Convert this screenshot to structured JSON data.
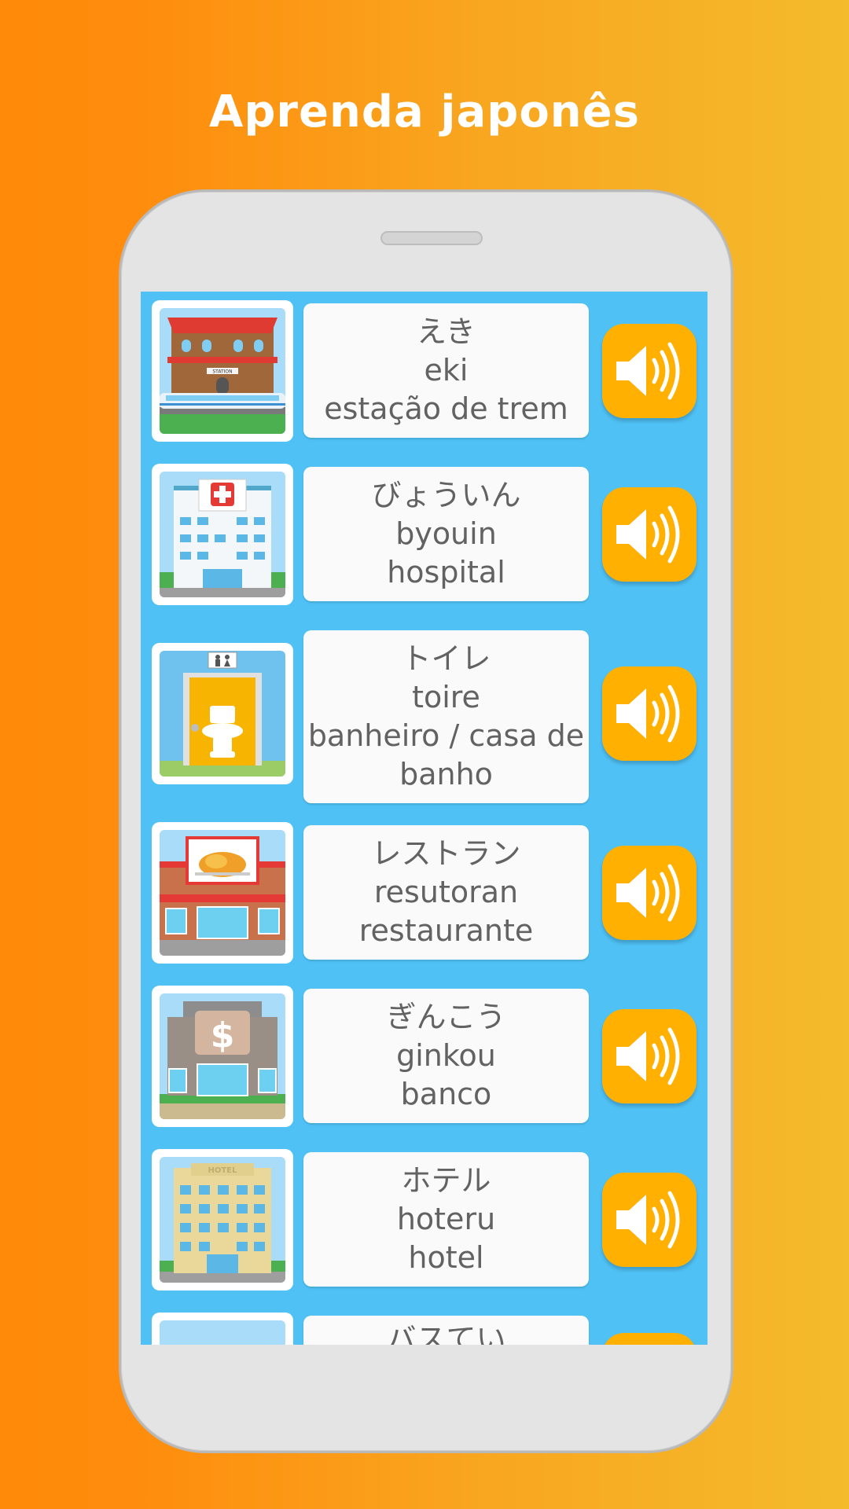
{
  "headline": "Aprenda japonês",
  "colors": {
    "accent": "#ffb000",
    "screen": "#4fc1f5",
    "card": "#fafafa",
    "text": "#626262"
  },
  "words": [
    {
      "kana": "えき",
      "romaji": "eki",
      "translation": "estação de trem",
      "image_icon": "train-station-icon"
    },
    {
      "kana": "びょういん",
      "romaji": "byouin",
      "translation": "hospital",
      "image_icon": "hospital-icon"
    },
    {
      "kana": "トイレ",
      "romaji": "toire",
      "translation": "banheiro / casa de banho",
      "image_icon": "toilet-icon"
    },
    {
      "kana": "レストラン",
      "romaji": "resutoran",
      "translation": "restaurante",
      "image_icon": "restaurant-icon"
    },
    {
      "kana": "ぎんこう",
      "romaji": "ginkou",
      "translation": "banco",
      "image_icon": "bank-icon"
    },
    {
      "kana": "ホテル",
      "romaji": "hoteru",
      "translation": "hotel",
      "image_icon": "hotel-icon"
    },
    {
      "kana": "バスてい",
      "romaji": "",
      "translation": "",
      "image_icon": "bus-stop-icon"
    }
  ],
  "image_labels": {
    "station_sign": "STATION",
    "hotel_sign": "HOTEL",
    "bank_symbol": "$"
  },
  "sound_icon": "speaker-icon"
}
